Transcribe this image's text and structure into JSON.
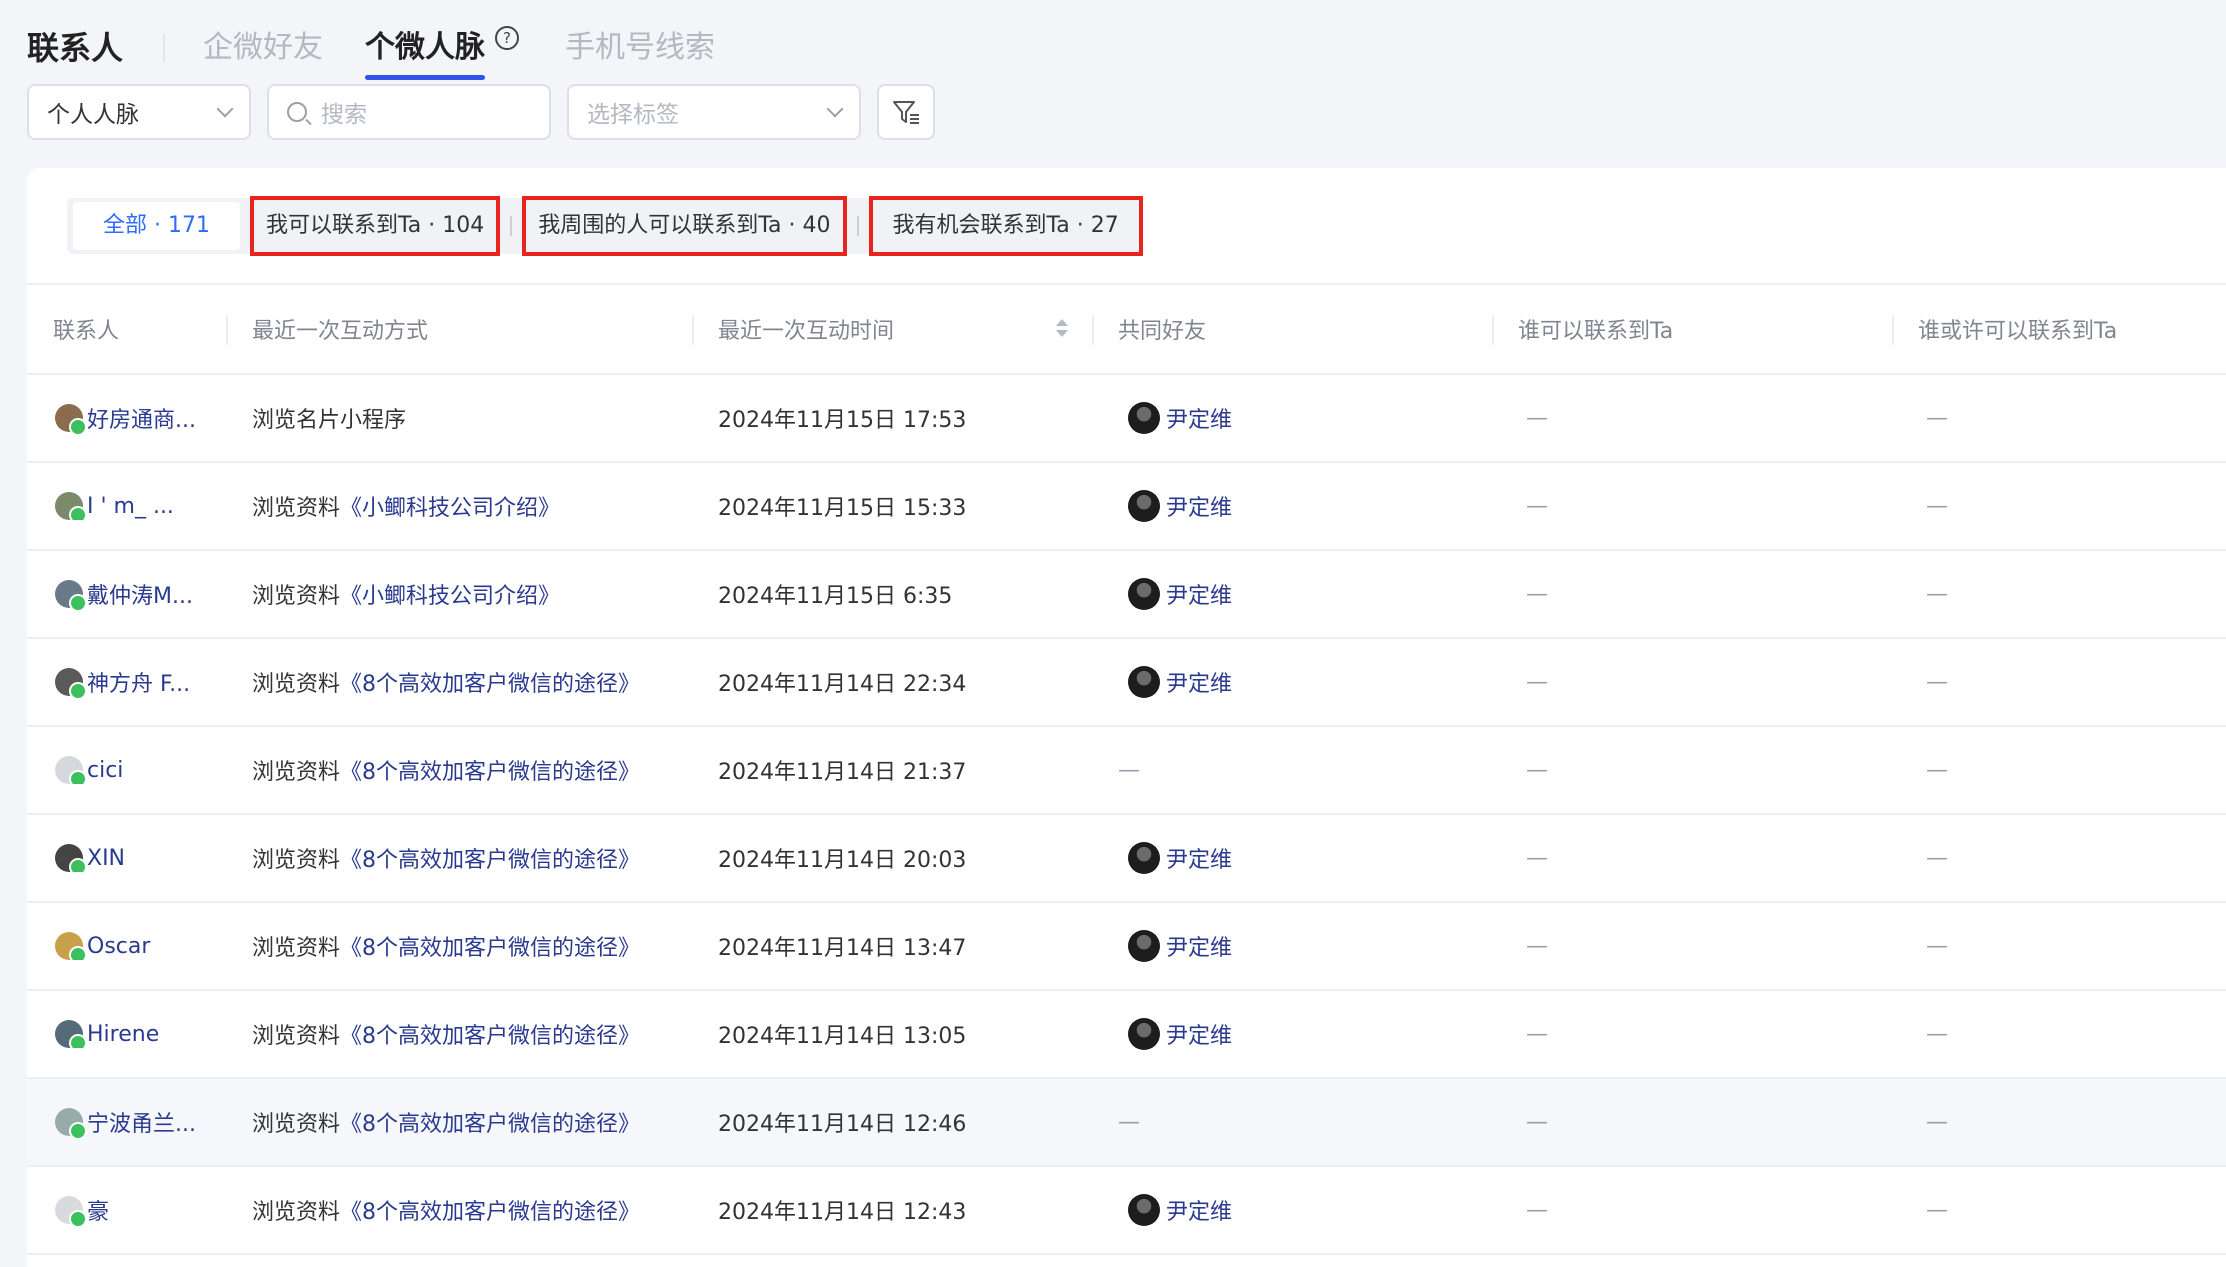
{
  "header": {
    "title": "联系人",
    "tabs": [
      {
        "label": "企微好友",
        "active": false
      },
      {
        "label": "个微人脉",
        "active": true
      },
      {
        "label": "手机号线索",
        "active": false
      }
    ],
    "help_glyph": "?"
  },
  "toolbar": {
    "person_select": "个人人脉",
    "search_placeholder": "搜索",
    "tag_placeholder": "选择标签"
  },
  "segments": [
    {
      "label": "全部 · 171"
    },
    {
      "label": "我可以联系到Ta · 104"
    },
    {
      "label": "我周围的人可以联系到Ta · 40"
    },
    {
      "label": "我有机会联系到Ta · 27"
    }
  ],
  "table": {
    "columns": [
      "联系人",
      "最近一次互动方式",
      "最近一次互动时间",
      "共同好友",
      "谁可以联系到Ta",
      "谁或许可以联系到Ta"
    ],
    "rows": [
      {
        "name": "好房通商...",
        "action_prefix": "浏览名片小程序",
        "action_link": "",
        "time": "2024年11月15日 17:53",
        "friend": "尹定维",
        "who": "—",
        "maybe": "—"
      },
      {
        "name": "I ' m_ ...",
        "action_prefix": "浏览资料",
        "action_link": "《小鲫科技公司介绍》",
        "time": "2024年11月15日 15:33",
        "friend": "尹定维",
        "who": "—",
        "maybe": "—"
      },
      {
        "name": "戴仲涛M...",
        "action_prefix": "浏览资料",
        "action_link": "《小鲫科技公司介绍》",
        "time": "2024年11月15日 6:35",
        "friend": "尹定维",
        "who": "—",
        "maybe": "—"
      },
      {
        "name": "神方舟 F...",
        "action_prefix": "浏览资料",
        "action_link": "《8个高效加客户微信的途径》",
        "time": "2024年11月14日 22:34",
        "friend": "尹定维",
        "who": "—",
        "maybe": "—"
      },
      {
        "name": "cici",
        "action_prefix": "浏览资料",
        "action_link": "《8个高效加客户微信的途径》",
        "time": "2024年11月14日 21:37",
        "friend": "—",
        "who": "—",
        "maybe": "—"
      },
      {
        "name": "XIN",
        "action_prefix": "浏览资料",
        "action_link": "《8个高效加客户微信的途径》",
        "time": "2024年11月14日 20:03",
        "friend": "尹定维",
        "who": "—",
        "maybe": "—"
      },
      {
        "name": "Oscar",
        "action_prefix": "浏览资料",
        "action_link": "《8个高效加客户微信的途径》",
        "time": "2024年11月14日 13:47",
        "friend": "尹定维",
        "who": "—",
        "maybe": "—"
      },
      {
        "name": "Hirene",
        "action_prefix": "浏览资料",
        "action_link": "《8个高效加客户微信的途径》",
        "time": "2024年11月14日 13:05",
        "friend": "尹定维",
        "who": "—",
        "maybe": "—"
      },
      {
        "name": "宁波甬兰...",
        "action_prefix": "浏览资料",
        "action_link": "《8个高效加客户微信的途径》",
        "time": "2024年11月14日 12:46",
        "friend": "—",
        "who": "—",
        "maybe": "—"
      },
      {
        "name": "豪",
        "action_prefix": "浏览资料",
        "action_link": "《8个高效加客户微信的途径》",
        "time": "2024年11月14日 12:43",
        "friend": "尹定维",
        "who": "—",
        "maybe": "—"
      }
    ]
  },
  "colors": {
    "accent": "#2f54eb",
    "highlight_box": "#e8241d",
    "link": "#2a3a8f",
    "wechat_badge": "#3cbf5d"
  }
}
